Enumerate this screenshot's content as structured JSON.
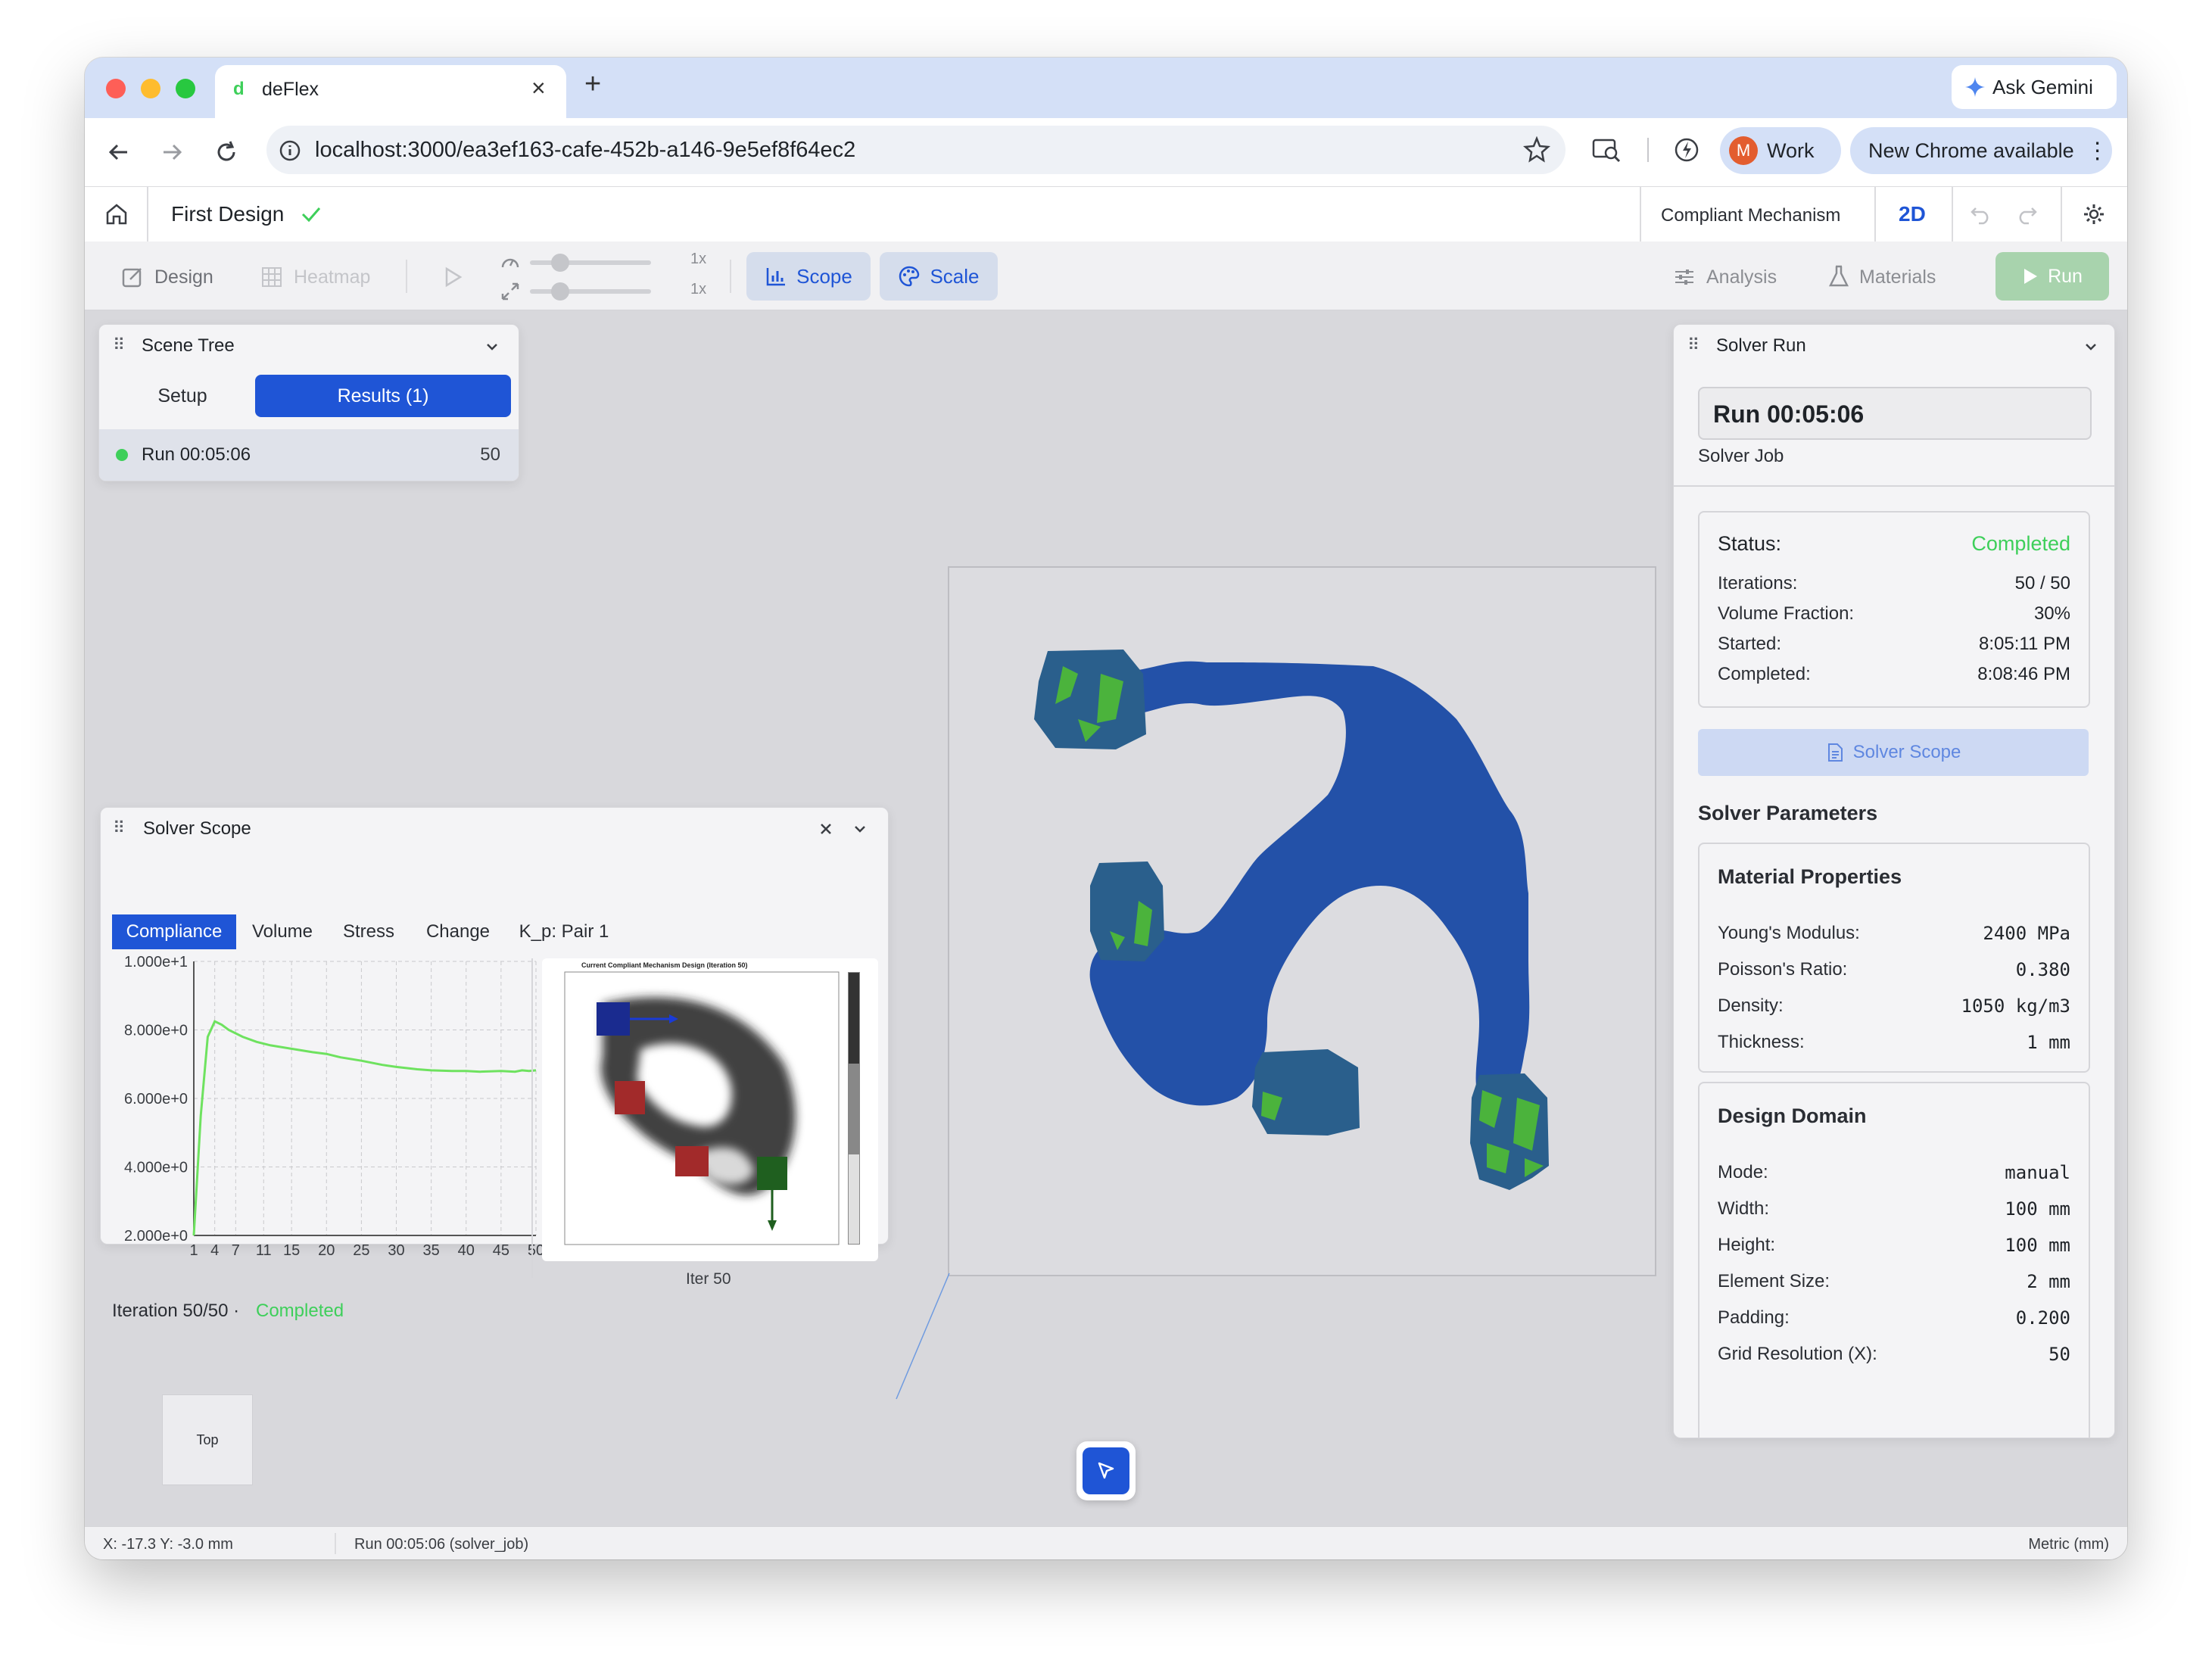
{
  "browser": {
    "tab_title": "deFlex",
    "favicon_letter": "d",
    "new_tab": "+",
    "close_tab": "×",
    "ask_gemini": "Ask Gemini",
    "url": "localhost:3000/ea3ef163-cafe-452b-a146-9e5ef8f64ec2",
    "profile_initial": "M",
    "profile_label": "Work",
    "update_label": "New Chrome available"
  },
  "header": {
    "design_name": "First Design",
    "mechanism": "Compliant Mechanism",
    "view_mode": "2D"
  },
  "toolbar": {
    "design": "Design",
    "heatmap": "Heatmap",
    "speed_label": "1x",
    "scale_label": "1x",
    "scope": "Scope",
    "scale": "Scale",
    "analysis": "Analysis",
    "materials": "Materials",
    "run": "Run",
    "speed_level": 0.25,
    "scale_level": 0.25
  },
  "scene_tree": {
    "title": "Scene Tree",
    "tabs": [
      "Setup",
      "Results (1)"
    ],
    "active_tab": 1,
    "run_name": "Run 00:05:06",
    "run_iterations": "50"
  },
  "solver_scope": {
    "title": "Solver Scope",
    "tabs": [
      "Compliance",
      "Volume",
      "Stress",
      "Change",
      "K_p: Pair 1"
    ],
    "active_tab": 0,
    "image_caption": "Iter 50",
    "image_title": "Current Compliant Mechanism Design (Iteration 50)",
    "footer_iteration": "Iteration 50/50 ·",
    "footer_status": "Completed"
  },
  "chart_data": {
    "type": "line",
    "y_ticks": [
      "1.000e+1",
      "8.000e+0",
      "6.000e+0",
      "4.000e+0",
      "2.000e+0"
    ],
    "x_ticks": [
      "1",
      "4",
      "7",
      "11",
      "15",
      "20",
      "25",
      "30",
      "35",
      "40",
      "45",
      "50"
    ],
    "ylim": [
      2.0,
      10.0
    ],
    "xlim": [
      1,
      50
    ],
    "grid": true,
    "line_color": "#6ee25f",
    "x": [
      1,
      2,
      3,
      4,
      5,
      6,
      8,
      10,
      12,
      15,
      18,
      20,
      22,
      25,
      28,
      30,
      33,
      35,
      38,
      40,
      42,
      45,
      47,
      48,
      49,
      50
    ],
    "y": [
      2.0,
      5.5,
      7.8,
      8.25,
      8.15,
      8.0,
      7.8,
      7.65,
      7.55,
      7.45,
      7.35,
      7.3,
      7.2,
      7.1,
      6.98,
      6.92,
      6.85,
      6.82,
      6.8,
      6.8,
      6.78,
      6.8,
      6.78,
      6.82,
      6.8,
      6.82
    ]
  },
  "viewport": {
    "view_label": "Top",
    "fill_color": "#2351a8",
    "pad_color": "#2a5f8c",
    "accent_color": "#4bb33c"
  },
  "solver_run": {
    "title": "Solver Run",
    "run_name": "Run 00:05:06",
    "subtitle": "Solver Job",
    "status_label": "Status:",
    "status_value": "Completed",
    "rows": [
      {
        "label": "Iterations:",
        "value": "50 / 50"
      },
      {
        "label": "Volume Fraction:",
        "value": "30%"
      },
      {
        "label": "Started:",
        "value": "8:05:11 PM"
      },
      {
        "label": "Completed:",
        "value": "8:08:46 PM"
      }
    ],
    "scope_button": "Solver Scope",
    "params_title": "Solver Parameters",
    "material_title": "Material Properties",
    "material": [
      {
        "label": "Young's Modulus:",
        "value": "2400 MPa"
      },
      {
        "label": "Poisson's Ratio:",
        "value": "0.380"
      },
      {
        "label": "Density:",
        "value": "1050 kg/m3"
      },
      {
        "label": "Thickness:",
        "value": "1 mm"
      }
    ],
    "domain_title": "Design Domain",
    "domain": [
      {
        "label": "Mode:",
        "value": "manual"
      },
      {
        "label": "Width:",
        "value": "100 mm"
      },
      {
        "label": "Height:",
        "value": "100 mm"
      },
      {
        "label": "Element Size:",
        "value": "2 mm"
      },
      {
        "label": "Padding:",
        "value": "0.200"
      },
      {
        "label": "Grid Resolution (X):",
        "value": "50"
      }
    ]
  },
  "statusbar": {
    "coords": "X: -17.3 Y: -3.0 mm",
    "run": "Run 00:05:06 (solver_job)",
    "units": "Metric (mm)"
  },
  "colors": {
    "primary": "#1f55d6",
    "success": "#3ecf5a",
    "run_button": "#a8d3ad"
  }
}
